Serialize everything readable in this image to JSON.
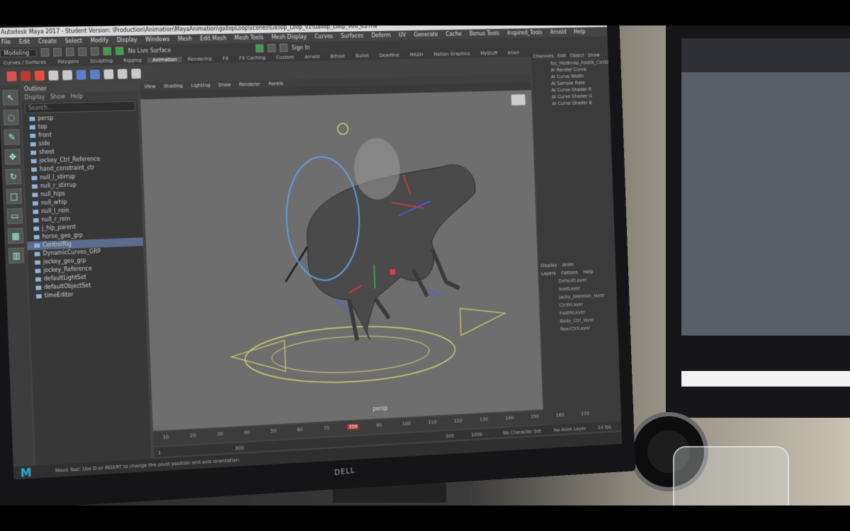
{
  "window": {
    "title": "Autodesk Maya 2017 - Student Version: \\Production\\Animation\\MayaAnimation\\gallopLoop\\scenes\\Gallop_Loop_v1\\Gallop_Loop_v06_05.ma*"
  },
  "menubar": [
    "File",
    "Edit",
    "Create",
    "Select",
    "Modify",
    "Display",
    "Windows",
    "Mesh",
    "Edit Mesh",
    "Mesh Tools",
    "Mesh Display",
    "Curves",
    "Surfaces",
    "Deform",
    "UV",
    "Generate",
    "Cache",
    "Bonus Tools",
    "Inspired_Tools",
    "Arnold",
    "Help"
  ],
  "statusline": {
    "mode": "Modeling",
    "live_surface": "No Live Surface",
    "sign_in": "Sign In"
  },
  "shelf_tabs": [
    "Curves / Surfaces",
    "Polygons",
    "Sculpting",
    "Rigging",
    "Animation",
    "Rendering",
    "FX",
    "FX Caching",
    "Custom",
    "Arnold",
    "Bifrost",
    "Bullet",
    "Deadline",
    "MASH",
    "Motion Graphics",
    "MyStuff",
    "XGen"
  ],
  "active_shelf_tab": "Animation",
  "outliner": {
    "title": "Outliner",
    "menu": [
      "Display",
      "Show",
      "Help"
    ],
    "search_placeholder": "Search...",
    "items": [
      "persp",
      "top",
      "front",
      "side",
      "sheet",
      "jockey_Ctrl_Reference",
      "hand_constraint_ctr",
      "null_l_stirrup",
      "null_r_stirrup",
      "null_hips",
      "null_whip",
      "null_l_rein",
      "null_r_rein",
      "j_hip_parent",
      "horse_geo_grp",
      "ControlRig",
      "DynamicCurves_GRP",
      "jockey_geo_grp",
      "jockey_Reference",
      "defaultLightSet",
      "defaultObjectSet",
      "timeEditor"
    ],
    "selected_index": 15
  },
  "viewport": {
    "menu": [
      "View",
      "Shading",
      "Lighting",
      "Show",
      "Renderer",
      "Panels"
    ],
    "camera_label": "persp"
  },
  "channel_box": {
    "tabs": [
      "Channels",
      "Edit",
      "Object",
      "Show"
    ],
    "object": "fcc_Hedknop_FootIk_CtrlShape",
    "attributes": [
      "Ai Render Curve",
      "Ai Curve Width",
      "Ai Sample Rate",
      "Ai Curve Shader R",
      "Ai Curve Shader G",
      "Ai Curve Shader B"
    ]
  },
  "layer_editor": {
    "tabs": [
      "Display",
      "Anim"
    ],
    "menu": [
      "Layers",
      "Options",
      "Help"
    ],
    "layers": [
      "DefaultLayer",
      "leadLayer",
      "jacky_Skeleton_layer",
      "CtrlIkLayer",
      "FootIkLayer",
      "Body_Ctrl_layer",
      "RearCtrlLayer"
    ]
  },
  "timeline": {
    "ticks": [
      "10",
      "20",
      "30",
      "40",
      "50",
      "60",
      "70",
      "80",
      "90",
      "100",
      "110",
      "120",
      "130",
      "140",
      "150",
      "160",
      "170"
    ],
    "current_frame": "154",
    "range_start": "1",
    "range_end": "300",
    "range_end_2": "300",
    "range_end_3": "1000",
    "no_character_set": "No Character Set",
    "no_anim_layer": "No Anim Layer",
    "fps": "24 fps"
  },
  "help_line": "Move Tool: Use D or INSERT to change the pivot position and axis orientation.",
  "monitor_brand": "DELL",
  "app_logo": "M"
}
